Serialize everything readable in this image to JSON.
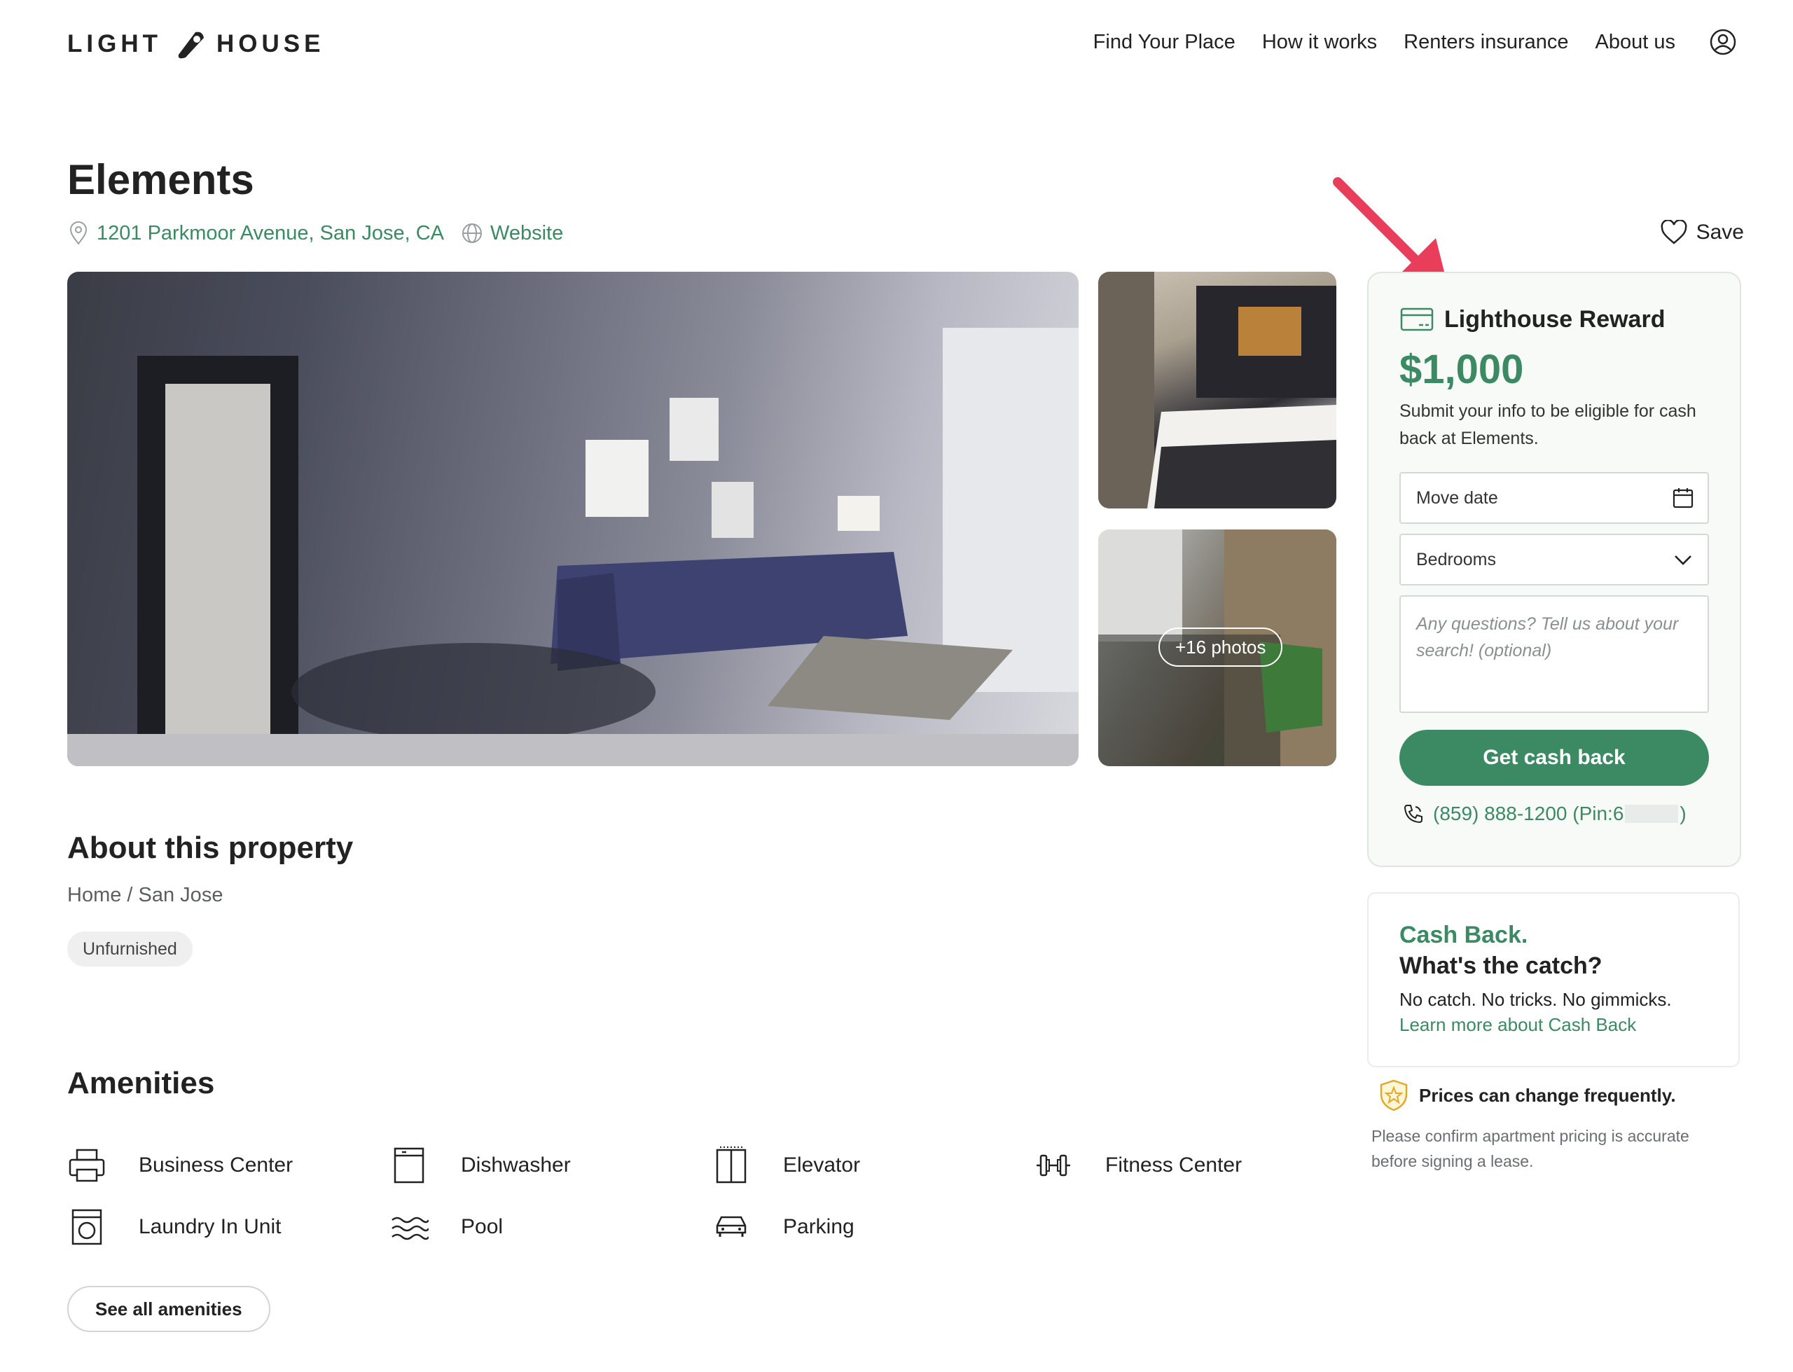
{
  "brand": {
    "left": "LIGHT",
    "right": "HOUSE",
    "accent": "#3b8a63"
  },
  "nav": {
    "items": [
      "Find Your Place",
      "How it works",
      "Renters insurance",
      "About us"
    ],
    "account_icon": "user-circle-icon"
  },
  "property": {
    "name": "Elements",
    "address": "1201 Parkmoor Avenue, San Jose, CA",
    "website_label": "Website",
    "save_label": "Save",
    "photos_more": "+16 photos"
  },
  "about": {
    "heading": "About this property",
    "breadcrumb": "Home / San Jose",
    "badge": "Unfurnished"
  },
  "amenities": {
    "heading": "Amenities",
    "items": [
      {
        "label": "Business Center",
        "icon": "printer-icon"
      },
      {
        "label": "Dishwasher",
        "icon": "dishwasher-icon"
      },
      {
        "label": "Elevator",
        "icon": "elevator-icon"
      },
      {
        "label": "Fitness Center",
        "icon": "dumbbell-icon"
      },
      {
        "label": "Laundry In Unit",
        "icon": "washer-icon"
      },
      {
        "label": "Pool",
        "icon": "waves-icon"
      },
      {
        "label": "Parking",
        "icon": "car-icon"
      }
    ],
    "see_all_label": "See all amenities"
  },
  "reward": {
    "title": "Lighthouse Reward",
    "amount": "$1,000",
    "description": "Submit your info to be eligible for cash back at Elements.",
    "move_date_placeholder": "Move date",
    "bedrooms_label": "Bedrooms",
    "questions_placeholder": "Any questions? Tell us about your search! (optional)",
    "cta_label": "Get cash back",
    "phone_prefix": "(859) 888-1200 (Pin:6",
    "phone_suffix": ")"
  },
  "cashback": {
    "title": "Cash Back.",
    "subtitle": "What's the catch?",
    "body": "No catch. No tricks. No gimmicks.",
    "link": "Learn more about Cash Back"
  },
  "notice": {
    "title": "Prices can change frequently.",
    "body": "Please confirm apartment pricing is accurate before signing a lease."
  },
  "colors": {
    "green": "#3b8a63",
    "arrow": "#e83e5c"
  }
}
